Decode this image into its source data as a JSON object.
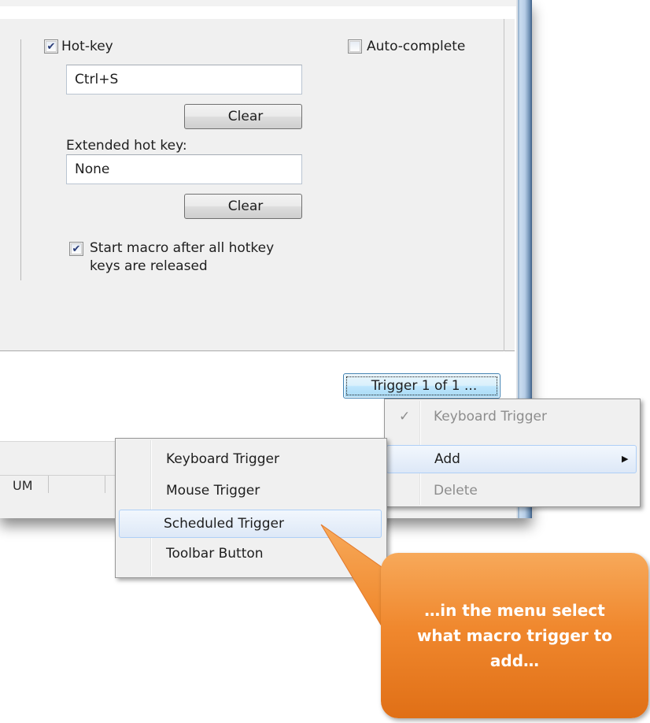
{
  "hotkey": {
    "checkbox_label": "Hot-key",
    "checked": true,
    "value": "Ctrl+S",
    "clear_label": "Clear"
  },
  "autocomplete": {
    "checkbox_label": "Auto-complete",
    "checked": false
  },
  "extended_hotkey": {
    "label": "Extended hot key:",
    "value": "None",
    "clear_label": "Clear"
  },
  "start_after_release": {
    "label_line1": "Start macro after all hotkey",
    "label_line2": "keys are released",
    "checked": true
  },
  "trigger_button": {
    "label": "Trigger 1 of 1 ..."
  },
  "status_bar": {
    "cell1": "UM"
  },
  "context_menu": {
    "items": [
      {
        "label": "Keyboard Trigger",
        "checked": true,
        "disabled": true
      },
      {
        "label": "Add",
        "submenu": true,
        "highlighted": true
      },
      {
        "label": "Delete",
        "disabled": true
      }
    ]
  },
  "add_submenu": {
    "items": [
      {
        "label": "Keyboard Trigger"
      },
      {
        "label": "Mouse Trigger"
      },
      {
        "label": "Scheduled Trigger",
        "highlighted": true
      },
      {
        "label": "Toolbar Button"
      }
    ]
  },
  "callout": {
    "text": "…in the menu select what macro trigger to add…",
    "color": "#f0882e"
  },
  "icons": {
    "check": "check-icon",
    "submenu_arrow": "chevron-right-icon"
  },
  "colors": {
    "frame": "#6d8fb3",
    "highlight": "#dde8f7",
    "callout": "#f0882e"
  }
}
